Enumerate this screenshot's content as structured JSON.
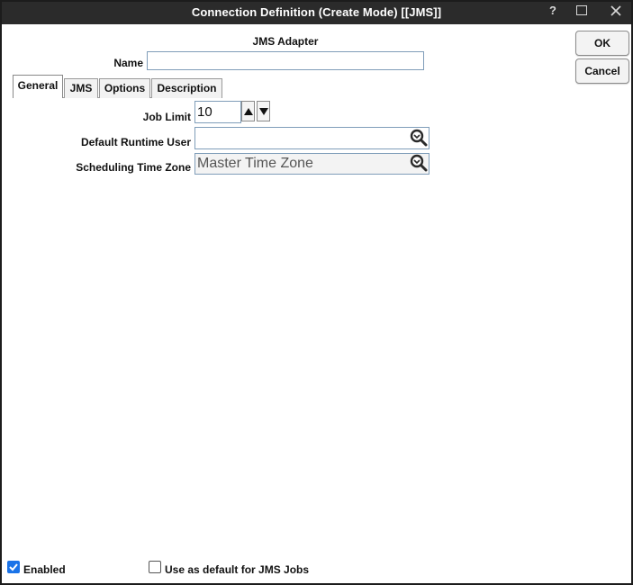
{
  "window": {
    "title": "Connection Definition (Create Mode) [[JMS]]",
    "help_glyph": "?"
  },
  "header": {
    "adapter_label": "JMS Adapter",
    "name_label": "Name",
    "name_value": ""
  },
  "buttons": {
    "ok": "OK",
    "cancel": "Cancel"
  },
  "tabs": [
    {
      "label": "General",
      "selected": true
    },
    {
      "label": "JMS",
      "selected": false
    },
    {
      "label": "Options",
      "selected": false
    },
    {
      "label": "Description",
      "selected": false
    }
  ],
  "general": {
    "job_limit_label": "Job Limit",
    "job_limit_value": "10",
    "runtime_user_label": "Default Runtime User",
    "runtime_user_value": "",
    "time_zone_label": "Scheduling Time Zone",
    "time_zone_value": "Master Time Zone"
  },
  "footer": {
    "enabled_label": "Enabled",
    "enabled_checked": true,
    "default_label": "Use as default for JMS Jobs",
    "default_checked": false
  },
  "icons": {
    "lookup": "magnifier-icon",
    "spin_up": "triangle-up-icon",
    "spin_down": "triangle-down-icon",
    "close": "close-icon",
    "maximize": "maximize-icon"
  },
  "colors": {
    "titlebar": "#2b2b2b",
    "checkbox_accent": "#1a73e8",
    "input_border": "#7f9db9"
  }
}
